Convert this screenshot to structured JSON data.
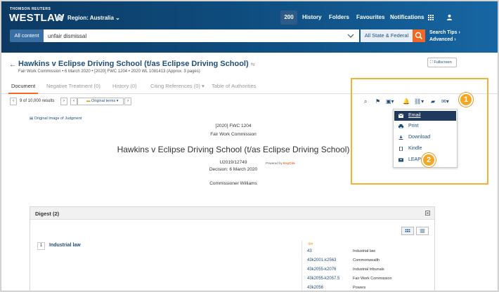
{
  "header": {
    "brand_small": "THOMSON REUTERS",
    "brand": "WESTLAW",
    "region": "Region: Australia",
    "nav": {
      "count": "200",
      "history": "History",
      "folders": "Folders",
      "favourites": "Favourites",
      "notifications": "Notifications"
    },
    "search": {
      "scope": "All content",
      "query": "unfair dismissal",
      "jurisdiction": "All State & Federal"
    },
    "tips": "Search Tips",
    "advanced": "Advanced"
  },
  "doc": {
    "title": "Hawkins v Eclipse Driving School (t/as Eclipse Driving School)",
    "meta": "Fair Work Commission  •  6 March 2020  •  [2020] FWC 1204  •  2020 WL 1081413  (Approx. 3 pages)",
    "fullscreen": "Fullscreen",
    "tabs": [
      "Document",
      "Negative Treatment (0)",
      "History (0)",
      "Citing References (0)",
      "Table of Authorities"
    ],
    "powered_by": "Powered by",
    "powered_brand": "KeyCite"
  },
  "toolbar": {
    "results": "9 of 10,000 results",
    "original_terms": "Original terms"
  },
  "body": {
    "original_image": "Original Image of Judgment",
    "cite": "[2020] FWC 1204",
    "court": "Fair Work Commission",
    "case_title": "Hawkins v Eclipse Driving School (t/as Eclipse Driving School)",
    "number": "U2019/12749",
    "decision": "Decision: 6 March 2020",
    "commissioner": "Commissioner Williams"
  },
  "digest": {
    "title": "Digest (2)",
    "item_number": "1",
    "item_label": "Industrial law",
    "key_codes": [
      "43",
      "43k2001-k2563",
      "43k2055-k2076",
      "43k2055-k2057.5",
      "43k2056"
    ],
    "key_descs": [
      "Industrial law",
      "Commonwealth",
      "Industrial tribunals",
      "Fair Work Commission",
      "Powers"
    ]
  },
  "menu": {
    "items": [
      "Email",
      "Print",
      "Download",
      "Kindle",
      "LEAP"
    ]
  },
  "annotations": {
    "badge1": "1",
    "badge2": "2"
  },
  "colors": {
    "header_dark": "#0d3a63",
    "accent_orange": "#f26722",
    "highlight": "#f2b233",
    "link": "#1f4d7a"
  }
}
